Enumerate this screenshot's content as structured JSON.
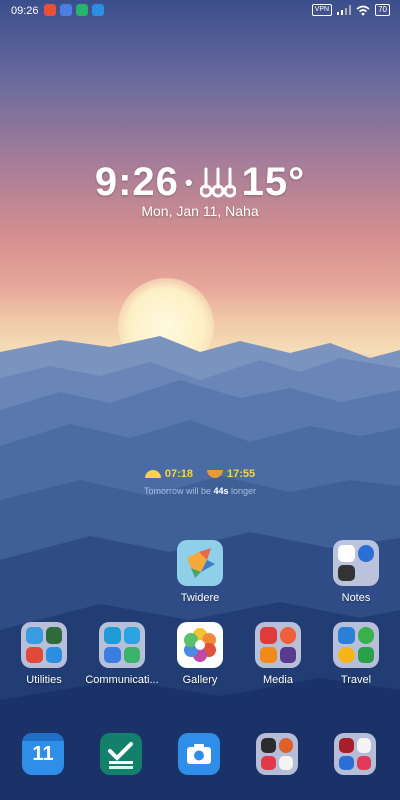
{
  "status_bar": {
    "time": "09:26",
    "vpn": "VPN",
    "battery": "70"
  },
  "clock_widget": {
    "hours_minutes": "9:26",
    "separator": "•",
    "temperature": "15°",
    "date_location": "Mon, Jan 11, Naha"
  },
  "sun_widget": {
    "sunrise": "07:18",
    "sunset": "17:55",
    "daylength_prefix": "Tomorrow will be",
    "daylength_value": "44s",
    "daylength_suffix": "longer"
  },
  "home_row1": [
    {
      "label": "Twidere",
      "icon": "twidere-bird-icon"
    },
    {
      "label": "Notes",
      "icon": "notes-folder-icon"
    }
  ],
  "home_row2": [
    {
      "label": "Utilities"
    },
    {
      "label": "Communicati..."
    },
    {
      "label": "Gallery"
    },
    {
      "label": "Media"
    },
    {
      "label": "Travel"
    }
  ],
  "dock": [
    {
      "icon": "calendar-icon",
      "text": "11"
    },
    {
      "icon": "tasks-check-icon"
    },
    {
      "icon": "camera-icon"
    },
    {
      "icon": "apps-folder-icon"
    },
    {
      "icon": "apps-folder-icon"
    }
  ],
  "colors": {
    "sunrise": "#f7d24a",
    "sunset": "#e89a3a",
    "calendar": "#2f8fe8",
    "tasks": "#13806b",
    "camera": "#2f8fe8"
  }
}
